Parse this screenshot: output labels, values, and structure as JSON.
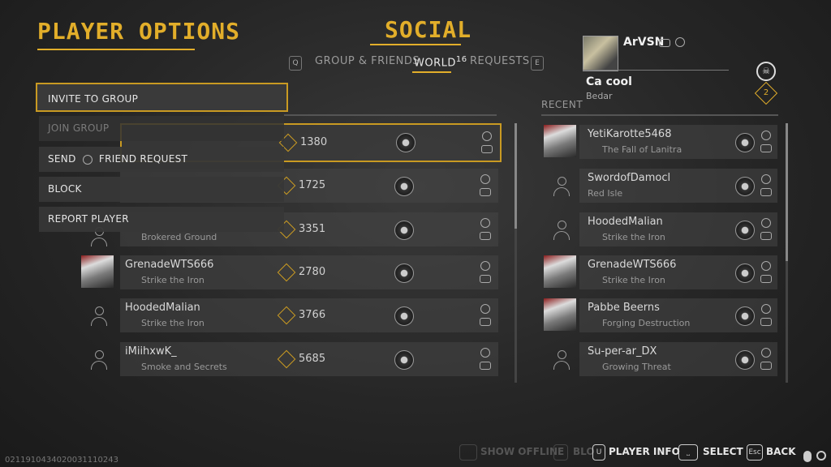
{
  "header": {
    "player_options_title": "PLAYER OPTIONS",
    "social_title": "SOCIAL"
  },
  "tabs": {
    "left_key": "Q",
    "right_key": "E",
    "items": [
      {
        "label": "GROUP & FRIENDS"
      },
      {
        "label": "WORLD",
        "count": "16"
      },
      {
        "label": "REQUESTS"
      }
    ],
    "active": "WORLD"
  },
  "self": {
    "name": "ArVSN",
    "status": "Ca cool",
    "location": "Bedar",
    "rank": "2",
    "icons": [
      "controller-icon",
      "ubisoft-icon"
    ]
  },
  "recent_header": "RECENT",
  "world_list": [
    {
      "name": "",
      "location": "",
      "score": "1380",
      "selected": true,
      "avatar": "placeholder"
    },
    {
      "name": "",
      "location": "",
      "score": "1725",
      "selected": false,
      "avatar": "placeholder"
    },
    {
      "name": "",
      "location": "Brokered Ground",
      "score": "3351",
      "selected": false,
      "avatar": "placeholder"
    },
    {
      "name": "GrenadeWTS666",
      "location": "Strike the Iron",
      "score": "2780",
      "selected": false,
      "avatar": "image"
    },
    {
      "name": "HoodedMalian",
      "location": "Strike the Iron",
      "score": "3766",
      "selected": false,
      "avatar": "placeholder"
    },
    {
      "name": "iMiihxwK_",
      "location": "Smoke and Secrets",
      "score": "5685",
      "selected": false,
      "avatar": "placeholder"
    }
  ],
  "recent_list": [
    {
      "name": "YetiKarotte5468",
      "location": "The Fall of Lanitra",
      "avatar": "image"
    },
    {
      "name": "SwordofDamocl",
      "location": "Red Isle",
      "avatar": "placeholder"
    },
    {
      "name": "HoodedMalian",
      "location": "Strike the Iron",
      "avatar": "placeholder"
    },
    {
      "name": "GrenadeWTS666",
      "location": "Strike the Iron",
      "avatar": "image"
    },
    {
      "name": "Pabbe Beerns",
      "location": "Forging Destruction",
      "avatar": "image"
    },
    {
      "name": "Su-per-ar_DX",
      "location": "Growing Threat",
      "avatar": "placeholder"
    }
  ],
  "menu": {
    "invite": "INVITE TO GROUP",
    "join": "JOIN GROUP",
    "send_friend_prefix": "SEND",
    "send_friend_suffix": "FRIEND REQUEST",
    "block": "BLOCK",
    "report": "REPORT PLAYER"
  },
  "footer": {
    "id": "0211910434020031110243",
    "show_offline": "SHOW OFFLINE",
    "block_list": "BLO",
    "player_info_key": "U",
    "player_info": "PLAYER INFO",
    "select_key": "⎵",
    "select": "SELECT",
    "back_key": "Esc",
    "back": "BACK"
  },
  "colors": {
    "accent": "#e2ae2a",
    "panel": "#464646",
    "background": "#262626"
  }
}
